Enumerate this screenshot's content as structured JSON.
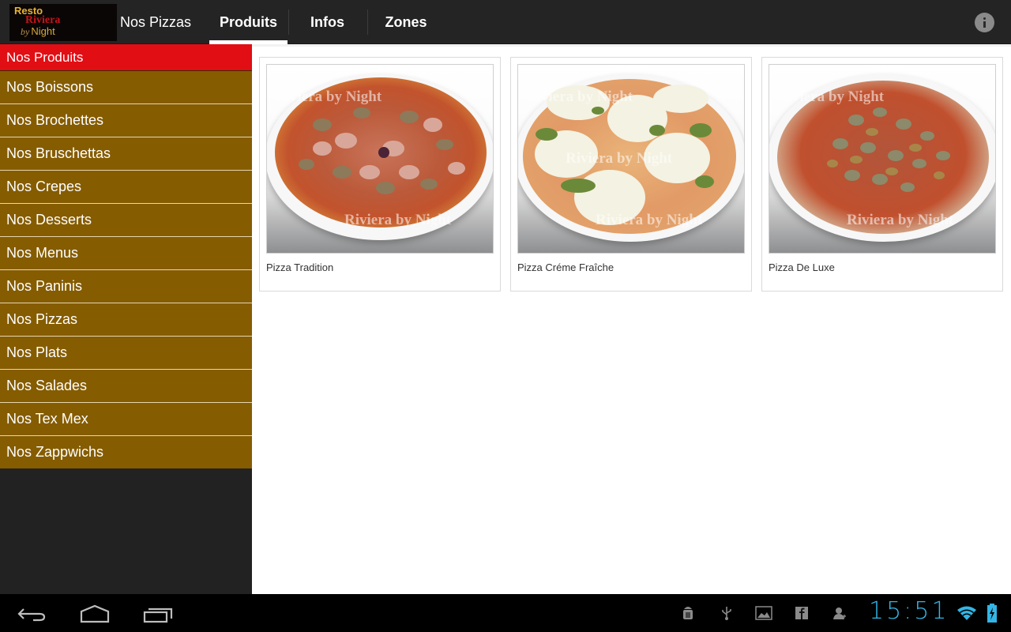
{
  "app": {
    "logo": {
      "line1": "Resto",
      "line2": "Riviera",
      "line3_prefix": "by",
      "line3": "Night"
    },
    "home_label": "Nos Pizzas",
    "tabs": [
      {
        "label": "Produits",
        "selected": true
      },
      {
        "label": "Infos",
        "selected": false
      },
      {
        "label": "Zones",
        "selected": false
      }
    ],
    "info_icon": "info-icon"
  },
  "sidebar": {
    "items": [
      {
        "label": "Nos Produits",
        "active": true
      },
      {
        "label": "Nos Boissons"
      },
      {
        "label": "Nos Brochettes"
      },
      {
        "label": "Nos Bruschettas"
      },
      {
        "label": "Nos Crepes"
      },
      {
        "label": "Nos Desserts"
      },
      {
        "label": "Nos Menus"
      },
      {
        "label": "Nos Paninis"
      },
      {
        "label": "Nos Pizzas"
      },
      {
        "label": "Nos Plats"
      },
      {
        "label": "Nos Salades"
      },
      {
        "label": "Nos Tex Mex"
      },
      {
        "label": "Nos Zappwichs"
      }
    ]
  },
  "products": [
    {
      "name": "Pizza Tradition",
      "watermark": "Riviera by Night"
    },
    {
      "name": "Pizza Créme Fraîche",
      "watermark": "Riviera by Night"
    },
    {
      "name": "Pizza De Luxe",
      "watermark": "Riviera by Night"
    }
  ],
  "colors": {
    "active_item": "#e10e14",
    "menu_item": "#855c00",
    "action_bar": "#242424",
    "clock": "#33b5e5"
  },
  "system_bar": {
    "nav_buttons": [
      "back-icon",
      "home-icon",
      "recent-apps-icon"
    ],
    "notification_icons": [
      "android-debug-icon",
      "usb-icon",
      "gallery-icon",
      "facebook-icon",
      "add-contact-icon"
    ],
    "clock": "15:51",
    "status_icons": [
      "wifi-icon",
      "battery-charging-icon"
    ]
  }
}
